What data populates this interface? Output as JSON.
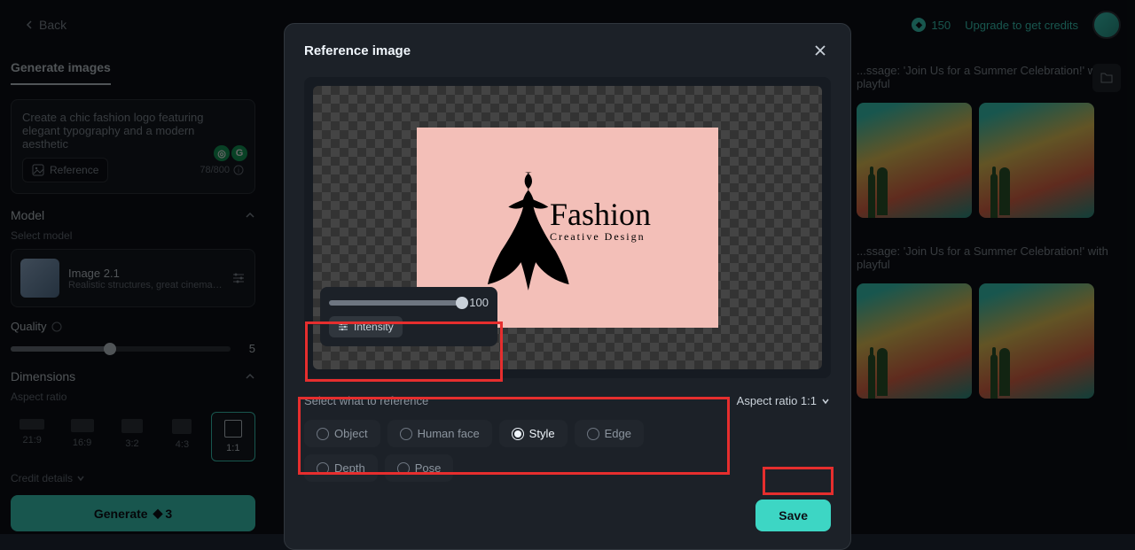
{
  "topbar": {
    "back_label": "Back",
    "credits": "150",
    "upgrade_label": "Upgrade to get credits"
  },
  "sidebar": {
    "title": "Generate images",
    "prompt": "Create a chic fashion logo featuring elegant typography and a modern aesthetic",
    "reference_label": "Reference",
    "char_count": "78/800",
    "model_section": "Model",
    "select_model_label": "Select model",
    "model_name": "Image 2.1",
    "model_desc": "Realistic structures, great cinematog...",
    "quality_label": "Quality",
    "quality_value": "5",
    "dimensions_label": "Dimensions",
    "aspect_label": "Aspect ratio",
    "ratios": [
      "21:9",
      "16:9",
      "3:2",
      "4:3",
      "1:1"
    ],
    "credit_details_label": "Credit details",
    "generate_label": "Generate",
    "generate_cost": "3"
  },
  "content": {
    "msg": "...ssage: 'Join Us for a Summer Celebration!' with playful"
  },
  "modal": {
    "title": "Reference image",
    "intensity_value": "100",
    "intensity_label": "Intensity",
    "select_label": "Select what to reference",
    "options": [
      "Object",
      "Human face",
      "Style",
      "Edge",
      "Depth",
      "Pose"
    ],
    "selected_option": "Style",
    "aspect_label": "Aspect ratio 1:1",
    "save_label": "Save",
    "logo_title": "Fashion",
    "logo_sub": "Creative Design"
  }
}
